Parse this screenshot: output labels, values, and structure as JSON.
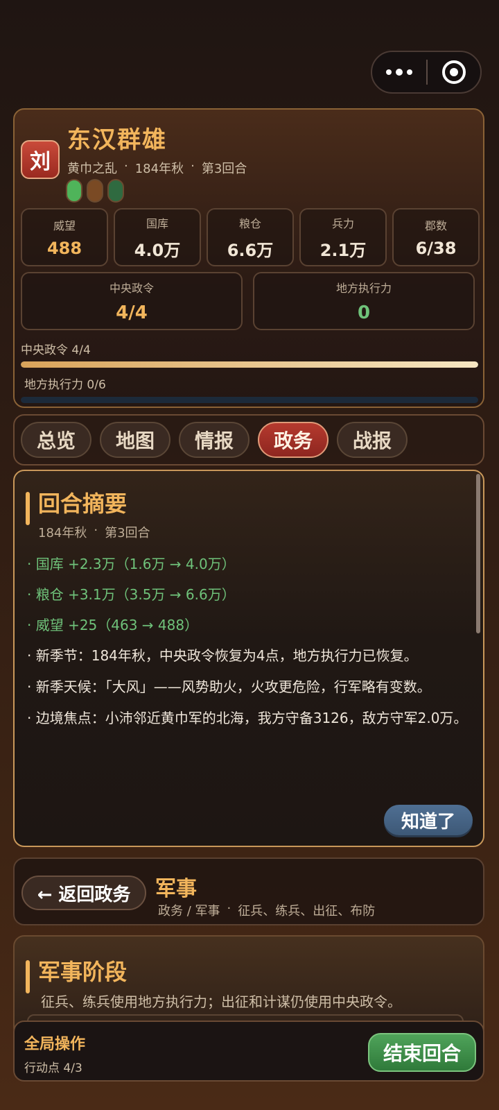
{
  "header": {
    "seal": "刘",
    "title": "东汉群雄",
    "era": "黄巾之乱",
    "season": "184年秋",
    "turn": "第3回合",
    "sep": "·",
    "pills": [
      "#4fb45a",
      "#7a4a24",
      "#2f6a40"
    ]
  },
  "stats": [
    {
      "label": "威望",
      "value": "488"
    },
    {
      "label": "国库",
      "value": "4.0万"
    },
    {
      "label": "粮仓",
      "value": "6.6万"
    },
    {
      "label": "兵力",
      "value": "2.1万"
    },
    {
      "label": "郡数",
      "value": "6/38"
    }
  ],
  "orders": {
    "central_label": "中央政令",
    "central_value": "4/4",
    "local_label": "地方执行力",
    "local_value": "0"
  },
  "bars": {
    "central_label": "中央政令 4/4",
    "central_fraction": 1.0,
    "local_label": "地方执行力 0/6",
    "local_fraction": 0.0
  },
  "tabs": [
    {
      "label": "总览",
      "active": false
    },
    {
      "label": "地图",
      "active": false
    },
    {
      "label": "情报",
      "active": false
    },
    {
      "label": "政务",
      "active": true
    },
    {
      "label": "战报",
      "active": false
    }
  ],
  "summary": {
    "title": "回合摘要",
    "season": "184年秋",
    "turn": "第3回合",
    "green_lines": [
      "· 国库 +2.3万（1.6万 → 4.0万）",
      "· 粮仓 +3.1万（3.5万 → 6.6万）",
      "· 威望 +25（463 → 488）"
    ],
    "white_lines": [
      "· 新季节：184年秋，中央政令恢复为4点，地方执行力已恢复。",
      "· 新季天候：「大风」——风势助火，火攻更危险，行军略有变数。",
      "· 边境焦点：小沛邻近黄巾军的北海，我方守备3126，敌方守军2.0万。"
    ],
    "ok_label": "知道了"
  },
  "military": {
    "back_label": "← 返回政务",
    "title": "军事",
    "path": "政务 / 军事",
    "tasks": "征兵、练兵、出征、布防"
  },
  "phase": {
    "title": "军事阶段",
    "desc": "征兵、练兵使用地方执行力；出征和计谋仍使用中央政令。"
  },
  "bottom": {
    "title": "全局操作",
    "actions": "行动点 4/3",
    "end_label": "结束回合"
  }
}
